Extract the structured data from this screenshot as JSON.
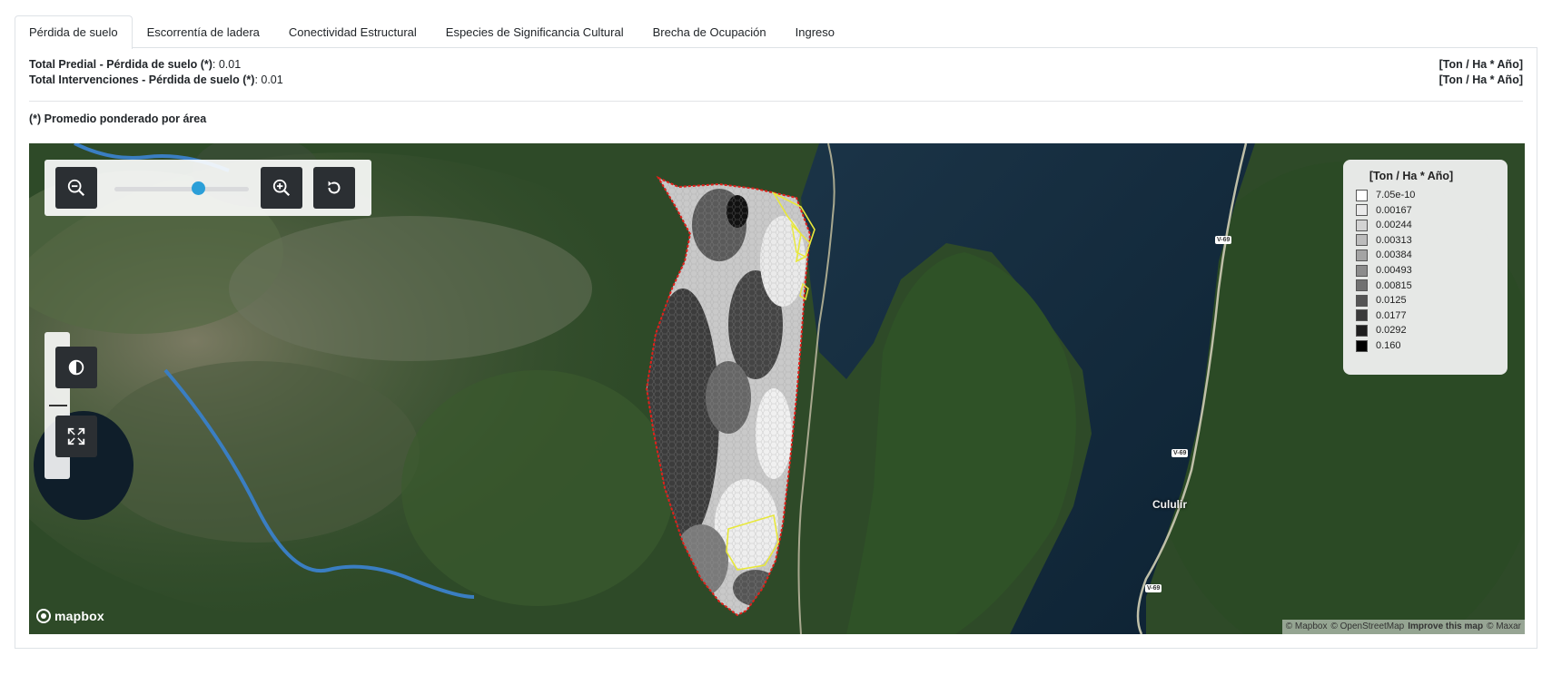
{
  "tabs": [
    {
      "label": "Pérdida de suelo",
      "active": true
    },
    {
      "label": "Escorrentía de ladera",
      "active": false
    },
    {
      "label": "Conectividad Estructural",
      "active": false
    },
    {
      "label": "Especies de Significancia Cultural",
      "active": false
    },
    {
      "label": "Brecha de Ocupación",
      "active": false
    },
    {
      "label": "Ingreso",
      "active": false
    }
  ],
  "summary": {
    "predial_label": "Total Predial - Pérdida de suelo (*)",
    "predial_value": ": 0.01",
    "interv_label": "Total Intervenciones - Pérdida de suelo (*)",
    "interv_value": ": 0.01",
    "unit": "[Ton / Ha * Año]",
    "note": "(*) Promedio ponderado por área"
  },
  "map": {
    "legend_title": "[Ton / Ha * Año]",
    "legend": [
      {
        "label": "7.05e-10",
        "color": "#ffffff"
      },
      {
        "label": "0.00167",
        "color": "#eaeaea"
      },
      {
        "label": "0.00244",
        "color": "#d3d3d3"
      },
      {
        "label": "0.00313",
        "color": "#bcbcbc"
      },
      {
        "label": "0.00384",
        "color": "#a4a4a4"
      },
      {
        "label": "0.00493",
        "color": "#8c8c8c"
      },
      {
        "label": "0.00815",
        "color": "#717171"
      },
      {
        "label": "0.0125",
        "color": "#555555"
      },
      {
        "label": "0.0177",
        "color": "#3a3a3a"
      },
      {
        "label": "0.0292",
        "color": "#1e1e1e"
      },
      {
        "label": "0.160",
        "color": "#000000"
      }
    ],
    "zoom_slider_level": 0.62,
    "icons": {
      "zoom_out": "zoom-out-icon",
      "zoom_in": "zoom-in-icon",
      "reset": "reset-icon",
      "contrast": "contrast-icon",
      "fullscreen": "fullscreen-icon"
    },
    "logo": "mapbox",
    "attribution": {
      "mapbox": "© Mapbox",
      "osm": "© OpenStreetMap",
      "improve": "Improve this map",
      "maxar": "© Maxar"
    },
    "road_labels": [
      "V-69",
      "V-69",
      "V-69"
    ],
    "place_label": "Cululir"
  }
}
